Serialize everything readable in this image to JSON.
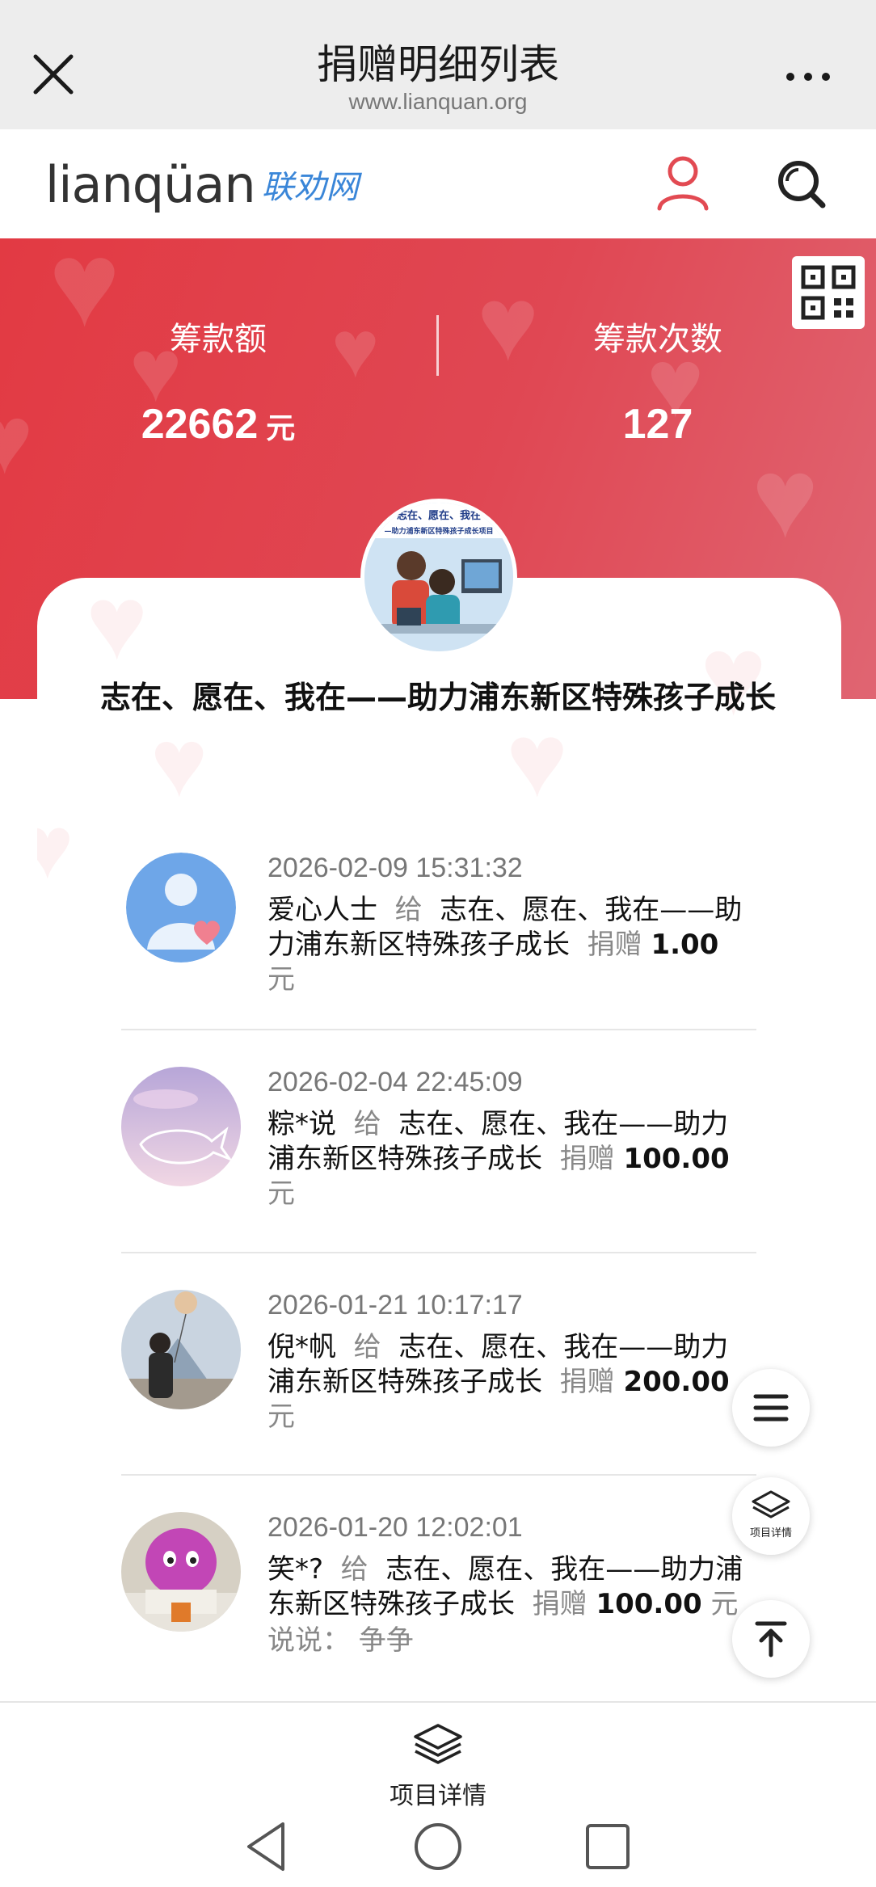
{
  "browser": {
    "title": "捐赠明细列表",
    "url": "www.lianquan.org"
  },
  "site": {
    "logo_text": "lianqüan",
    "logo_cn": "联劝网"
  },
  "stats": {
    "amount_label": "筹款额",
    "amount_value": "22662",
    "amount_unit": "元",
    "count_label": "筹款次数",
    "count_value": "127"
  },
  "project": {
    "avatar_caption": "志在、愿在、我在 —助力浦东新区特殊孩子成长项目",
    "title": "志在、愿在、我在——助力浦东新区特殊孩子成长"
  },
  "donations": [
    {
      "time": "2026-02-09 15:31:32",
      "donor": "爱心人士",
      "give_word": "给",
      "project": "志在、愿在、我在——助力浦东新区特殊孩子成长",
      "donate_word": "捐赠",
      "amount": "1.00",
      "unit": "元"
    },
    {
      "time": "2026-02-04 22:45:09",
      "donor": "粽*说",
      "give_word": "给",
      "project": "志在、愿在、我在——助力浦东新区特殊孩子成长",
      "donate_word": "捐赠",
      "amount": "100.00",
      "unit": "元"
    },
    {
      "time": "2026-01-21 10:17:17",
      "donor": "倪*帆",
      "give_word": "给",
      "project": "志在、愿在、我在——助力浦东新区特殊孩子成长",
      "donate_word": "捐赠",
      "amount": "200.00",
      "unit": "元"
    },
    {
      "time": "2026-01-20 12:02:01",
      "donor": "笑*?",
      "give_word": "给",
      "project": "志在、愿在、我在——助力浦东新区特殊孩子成长",
      "donate_word": "捐赠",
      "amount": "100.00",
      "unit": "元",
      "message": "说说：  争争"
    }
  ],
  "fab": {
    "detail_label": "项目详情"
  },
  "bottom": {
    "detail_label": "项目详情"
  },
  "colors": {
    "banner": "#e23a43",
    "accent_logo": "#3a86d8",
    "user_icon": "#e24a52"
  }
}
